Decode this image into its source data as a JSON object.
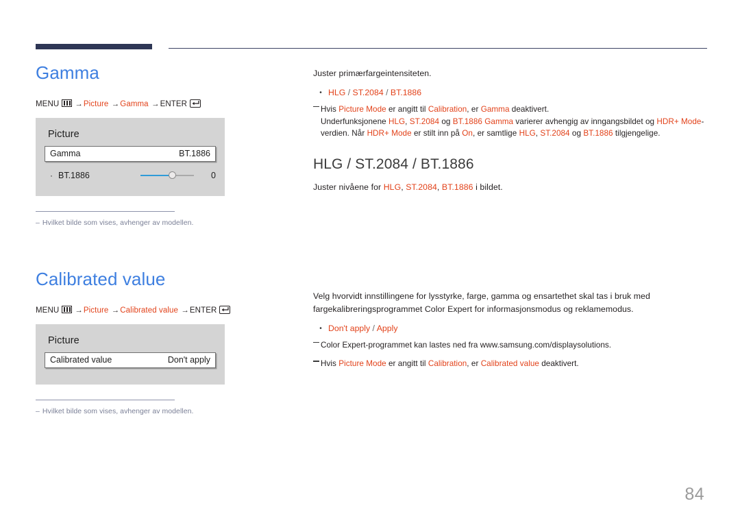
{
  "header": {
    "rule_color": "#2e3655"
  },
  "page_number": "84",
  "sections": {
    "gamma": {
      "title": "Gamma",
      "menu_path": {
        "menu_label": "MENU",
        "menu_icon": "menu-grid-icon",
        "arrow": "→",
        "step1": "Picture",
        "step2": "Gamma",
        "enter_label": "ENTER",
        "enter_icon": "enter-arrow-icon"
      },
      "osd": {
        "title": "Picture",
        "row_label": "Gamma",
        "row_value": "BT.1886",
        "sub_bullet": "·",
        "sub_label": "BT.1886",
        "slider_value": "0"
      },
      "footnote": "Hvilket bilde som vises, avhenger av modellen.",
      "footnote_dash": "–"
    },
    "calibrated_value": {
      "title": "Calibrated value",
      "menu_path": {
        "menu_label": "MENU",
        "menu_icon": "menu-grid-icon",
        "arrow": "→",
        "step1": "Picture",
        "step2": "Calibrated value",
        "enter_label": "ENTER",
        "enter_icon": "enter-arrow-icon"
      },
      "osd": {
        "title": "Picture",
        "row_label": "Calibrated value",
        "row_value": "Don't apply"
      },
      "footnote": "Hvilket bilde som vises, avhenger av modellen.",
      "footnote_dash": "–"
    }
  },
  "right_column": {
    "gamma_intro": "Juster primærfargeintensiteten.",
    "gamma_bullet": {
      "opt1": "HLG",
      "sep1": " / ",
      "opt2": "ST.2084",
      "sep2": " / ",
      "opt3": "BT.1886"
    },
    "gamma_note": {
      "p1_a": "Hvis ",
      "p1_b": "Picture Mode",
      "p1_c": " er angitt til ",
      "p1_d": "Calibration",
      "p1_e": ", er ",
      "p1_f": "Gamma",
      "p1_g": " deaktivert.",
      "p2_a": "Underfunksjonene ",
      "p2_b": "HLG",
      "p2_c": ", ",
      "p2_d": "ST.2084",
      "p2_e": " og ",
      "p2_f": "BT.1886 Gamma",
      "p2_g": " varierer avhengig av inngangsbildet og ",
      "p2_h": "HDR+ Mode",
      "p2_i": "-verdien. Når ",
      "p2_j": "HDR+ Mode",
      "p2_k": " er stilt inn på ",
      "p2_l": "On",
      "p2_m": ", er samtlige ",
      "p2_n": "HLG",
      "p2_o": ", ",
      "p2_p": "ST.2084",
      "p2_q": " og ",
      "p2_r": "BT.1886",
      "p2_s": " tilgjengelige."
    },
    "hlg_heading": "HLG / ST.2084 / BT.1886",
    "hlg_body": {
      "a": "Juster nivåene for ",
      "b": "HLG",
      "c": ", ",
      "d": "ST.2084",
      "e": ", ",
      "f": "BT.1886",
      "g": " i bildet."
    },
    "calib_intro_line1": "Velg hvorvidt innstillingene for lysstyrke, farge, gamma og ensartethet skal tas i bruk med",
    "calib_intro_line2": "fargekalibreringsprogrammet Color Expert for informasjonsmodus og reklamemodus.",
    "calib_bullet": {
      "opt1": "Don't apply",
      "sep1": " / ",
      "opt2": "Apply"
    },
    "calib_note1": "Color Expert-programmet kan lastes ned fra www.samsung.com/displaysolutions.",
    "calib_note2": {
      "a": "Hvis ",
      "b": "Picture Mode",
      "c": " er angitt til ",
      "d": "Calibration",
      "e": ", er ",
      "f": "Calibrated value",
      "g": " deaktivert."
    }
  },
  "colors": {
    "accent": "#e2421a",
    "heading_blue": "#3e7fe0",
    "rule_navy": "#2e3655",
    "footnote_gray": "#7b8097",
    "slider_blue": "#2f9bd8"
  }
}
